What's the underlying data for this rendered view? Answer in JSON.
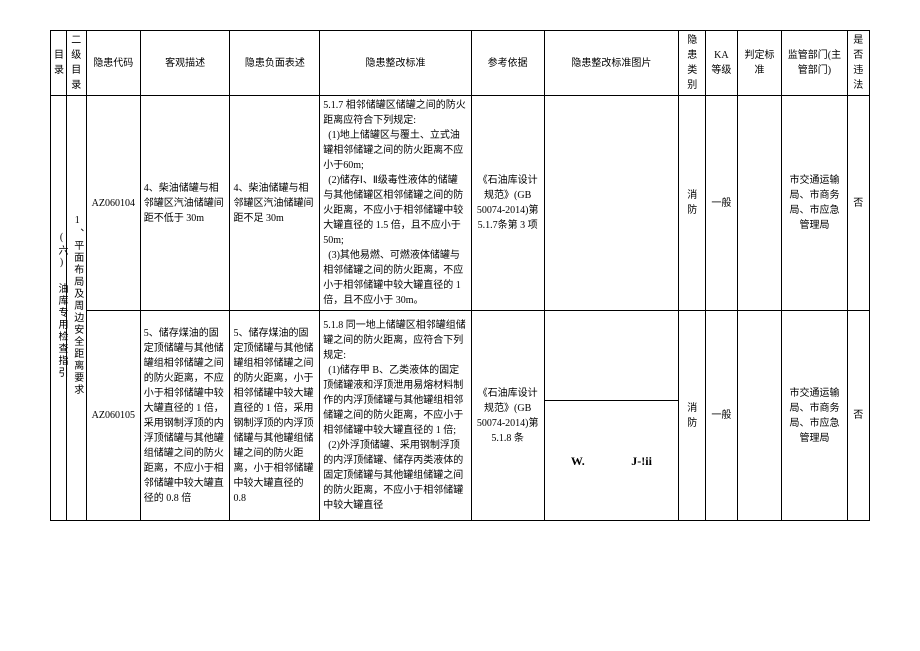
{
  "headers": {
    "catalog": "目录",
    "sub_catalog": "二级目录",
    "hazard_code": "隐患代码",
    "objective_desc": "客观描述",
    "negative_desc": "隐患负面表述",
    "rectify_standard": "隐患整改标准",
    "reference": "参考依据",
    "rectify_image": "隐患整改标准图片",
    "hazard_category": "隐患类别",
    "ka_level": "KA等级",
    "judge_standard": "判定标准",
    "supervise_dept": "监管部门(主管部门)",
    "is_illegal": "是否违法"
  },
  "catalog_label": "(六) 油库专用检查指引",
  "sub_catalog_label": "1、平面布局及周边安全距离要求",
  "rows": [
    {
      "code": "AZ060104",
      "objective": "4、柴油储罐与相邻罐区汽油储罐间距不低于 30m",
      "negative": "4、柴油储罐与相邻罐区汽油储罐间距不足 30m",
      "standard": "5.1.7 相邻储罐区储罐之间的防火距离应符合下列规定:\n  (1)地上储罐区与覆土、立式油罐相邻储罐之间的防火距离不应小于60m;\n  (2)储存Ⅰ、Ⅱ级毒性液体的储罐与其他储罐区相邻储罐之间的防火距离，不应小于相邻储罐中较大罐直径的 1.5 倍，且不应小于 50m;\n  (3)其他易燃、可燃液体储罐与相邻储罐之间的防火距离，不应小于相邻储罐中较大罐直径的 1 倍，且不应小于 30m。",
      "reference": "《石油库设计规范》(GB 50074-2014)第5.1.7条第 3 项",
      "category": "消防",
      "ka": "一般",
      "judge": "",
      "dept": "市交通运输局、市商务局、市应急管理局",
      "illegal": "否"
    },
    {
      "code": "AZ060105",
      "objective": "5、储存煤油的固定顶储罐与其他储罐组相邻储罐之间的防火距离，不应小于相邻储罐中较大罐直径的 1 倍，采用钢制浮顶的内浮顶储罐与其他罐组储罐之间的防火距离，不应小于相邻储罐中较大罐直径的 0.8 倍",
      "negative": "5、储存煤油的固定顶储罐与其他储罐组相邻储罐之间的防火距离，小于相邻储罐中较大罐直径的 1 倍，采用钢制浮顶的内浮顶储罐与其他罐组储罐之间的防火距离，小于相邻储罐中较大罐直径的 0.8",
      "standard": "5.1.8 同一地上储罐区相邻罐组储罐之间的防火距离，应符合下列规定:\n  (1)储存甲 B、乙类液体的固定顶储罐液和浮顶泄用易熔材料制作的内浮顶储罐与其他罐组相邻储罐之间的防火距离，不应小于相邻储罐中较大罐直径的 1 倍;\n  (2)外浮顶储罐、采用钢制浮顶的内浮顶储罐、储存丙类液体的固定顶储罐与其他罐组储罐之间的防火距离，不应小于相邻储罐中较大罐直径",
      "reference": "《石油库设计规范》(GB 50074-2014)第5.1.8 条",
      "img_marks": {
        "w": "W.",
        "j": "J-!ii"
      },
      "category": "消防",
      "ka": "一般",
      "judge": "",
      "dept": "市交通运输局、市商务局、市应急管理局",
      "illegal": "否"
    }
  ]
}
